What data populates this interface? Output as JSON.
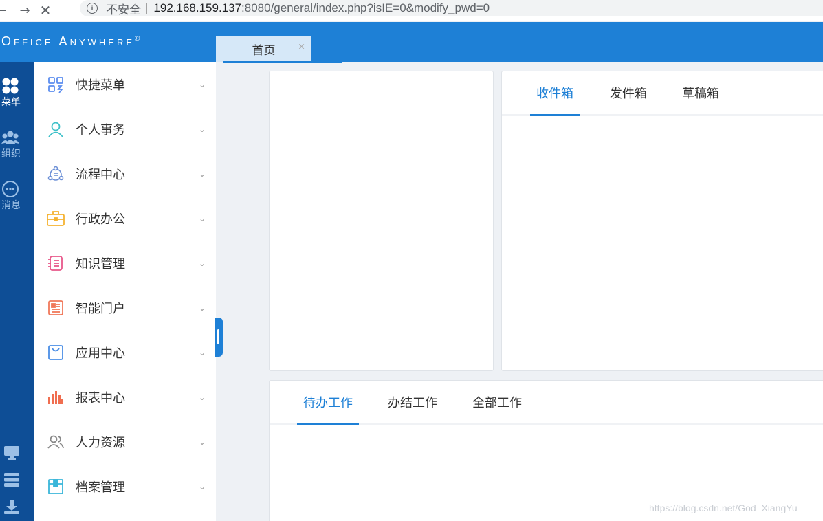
{
  "browser": {
    "back": "←",
    "forward": "→",
    "stop": "✕",
    "info": "i",
    "insecure_label": "不安全",
    "separator": "|",
    "url_host": "192.168.159.137",
    "url_rest": ":8080/general/index.php?isIE=0&modify_pwd=0"
  },
  "header": {
    "brand": "Office Anywhere",
    "brand_mark": "®",
    "tab_label": "首页",
    "tab_close": "×"
  },
  "rail": {
    "items": [
      {
        "label": "菜单",
        "icon": "apps-icon"
      },
      {
        "label": "组织",
        "icon": "users-icon"
      },
      {
        "label": "消息",
        "icon": "chat-icon"
      }
    ],
    "bottom_icons": [
      "monitor-icon",
      "server-icon",
      "download-icon"
    ]
  },
  "menu": {
    "items": [
      {
        "label": "快捷菜单",
        "icon": "quick-menu-icon",
        "color": "#5b8def"
      },
      {
        "label": "个人事务",
        "icon": "person-icon",
        "color": "#3ec1c9"
      },
      {
        "label": "流程中心",
        "icon": "workflow-icon",
        "color": "#6b8fd6"
      },
      {
        "label": "行政办公",
        "icon": "briefcase-icon",
        "color": "#f5b331"
      },
      {
        "label": "知识管理",
        "icon": "notebook-icon",
        "color": "#e8588a"
      },
      {
        "label": "智能门户",
        "icon": "portal-icon",
        "color": "#f0785a"
      },
      {
        "label": "应用中心",
        "icon": "bag-icon",
        "color": "#4a8ee6"
      },
      {
        "label": "报表中心",
        "icon": "bar-chart-icon",
        "color": "#f06e50"
      },
      {
        "label": "人力资源",
        "icon": "people-icon",
        "color": "#888888"
      },
      {
        "label": "档案管理",
        "icon": "archive-icon",
        "color": "#3ab6d9"
      }
    ],
    "chevron": "⌄"
  },
  "mail_panel": {
    "tabs": [
      "收件箱",
      "发件箱",
      "草稿箱"
    ],
    "active": 0
  },
  "work_panel": {
    "tabs": [
      "待办工作",
      "办结工作",
      "全部工作"
    ],
    "active": 0
  },
  "watermark": "https://blog.csdn.net/God_XiangYu",
  "colors": {
    "header": "#1e80d6",
    "rail": "#0e4e96",
    "accent": "#1e80d6"
  }
}
